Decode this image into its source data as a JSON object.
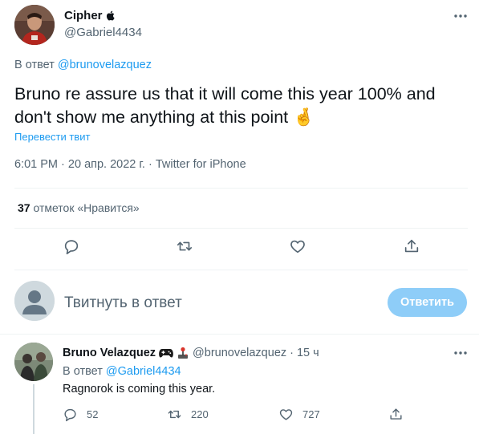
{
  "tweet": {
    "author_name": "Cipher",
    "author_handle": "@Gabriel4434",
    "reply_prefix": "В ответ",
    "reply_to_handle": "@brunovelazquez",
    "text": "Bruno re assure us that it will come this year 100% and don't show me anything at this point",
    "emoji": "🤞",
    "translate_label": "Перевести твит",
    "time": "6:01 PM",
    "date": "20 апр. 2022 г.",
    "source": "Twitter for iPhone",
    "separator": "·",
    "likes_count": "37",
    "likes_label": "отметок «Нравится»"
  },
  "compose": {
    "placeholder": "Твитнуть в ответ",
    "button_label": "Ответить"
  },
  "reply": {
    "author_name": "Bruno Velazquez",
    "author_handle": "@brunovelazquez",
    "separator": "·",
    "time_ago": "15 ч",
    "reply_prefix": "В ответ",
    "reply_to_handle": "@Gabriel4434",
    "text": "Ragnorok is coming this year.",
    "reply_count": "52",
    "retweet_count": "220",
    "like_count": "727"
  },
  "colors": {
    "accent": "#1d9bf0",
    "button_disabled": "#8ecdf8",
    "secondary_text": "#536471",
    "primary_text": "#0f1419",
    "divider": "#eff3f4"
  },
  "icons": {
    "author_badge": "apple-icon",
    "more": "more-horizontal-icon",
    "reply": "speech-bubble-icon",
    "retweet": "retweet-icon",
    "like": "heart-icon",
    "share": "share-upload-icon",
    "reply_author_badges": [
      "gamepad-icon",
      "joystick-icon"
    ]
  }
}
